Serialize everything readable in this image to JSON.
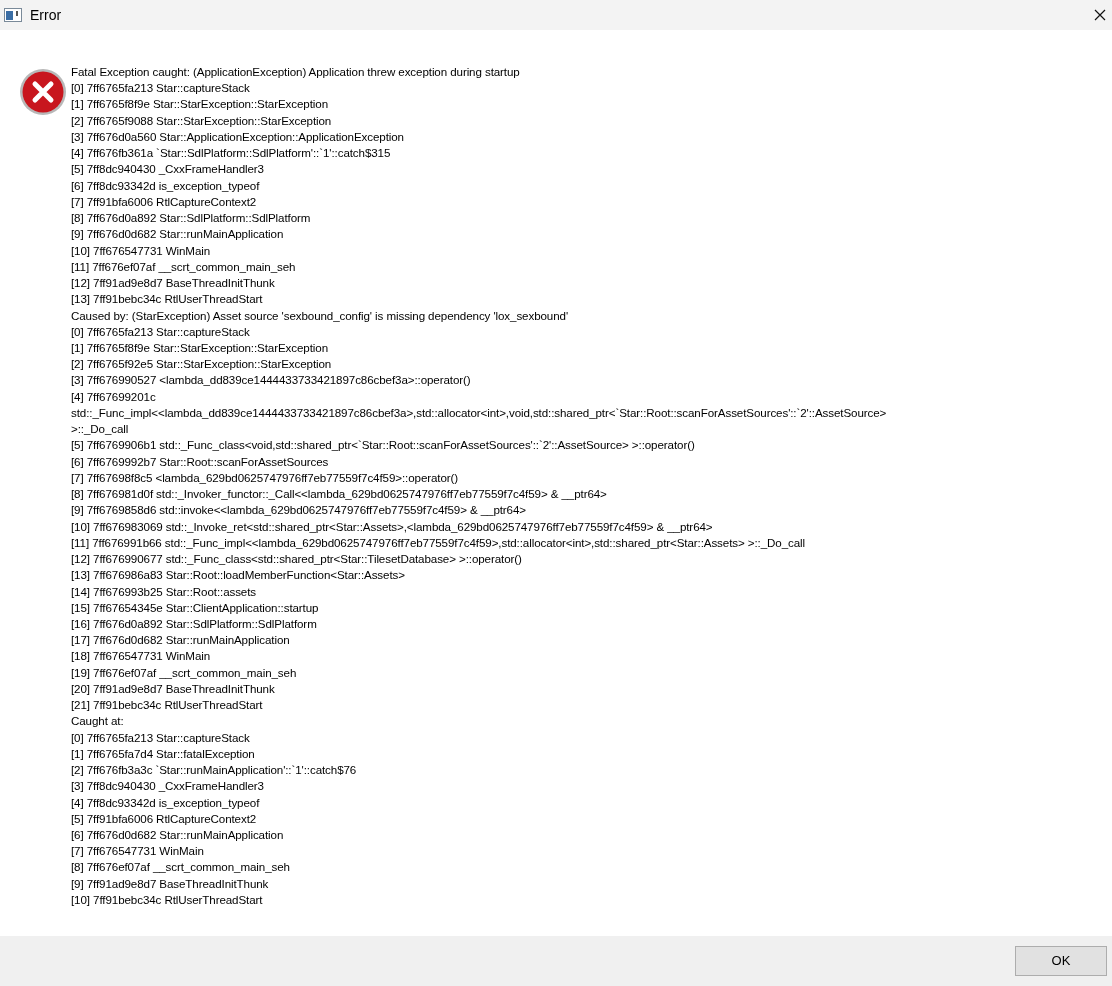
{
  "window": {
    "title": "Error"
  },
  "message": {
    "lines": [
      "Fatal Exception caught: (ApplicationException) Application threw exception during startup",
      "[0] 7ff6765fa213 Star::captureStack",
      "[1] 7ff6765f8f9e Star::StarException::StarException",
      "[2] 7ff6765f9088 Star::StarException::StarException",
      "[3] 7ff676d0a560 Star::ApplicationException::ApplicationException",
      "[4] 7ff676fb361a `Star::SdlPlatform::SdlPlatform'::`1'::catch$315",
      "[5] 7ff8dc940430 _CxxFrameHandler3",
      "[6] 7ff8dc93342d is_exception_typeof",
      "[7] 7ff91bfa6006 RtlCaptureContext2",
      "[8] 7ff676d0a892 Star::SdlPlatform::SdlPlatform",
      "[9] 7ff676d0d682 Star::runMainApplication",
      "[10] 7ff676547731 WinMain",
      "[11] 7ff676ef07af __scrt_common_main_seh",
      "[12] 7ff91ad9e8d7 BaseThreadInitThunk",
      "[13] 7ff91bebc34c RtlUserThreadStart",
      "Caused by: (StarException) Asset source 'sexbound_config' is missing dependency 'lox_sexbound'",
      "[0] 7ff6765fa213 Star::captureStack",
      "[1] 7ff6765f8f9e Star::StarException::StarException",
      "[2] 7ff6765f92e5 Star::StarException::StarException",
      "[3] 7ff676990527 <lambda_dd839ce1444433733421897c86cbef3a>::operator()",
      "[4] 7ff67699201c",
      "std::_Func_impl<<lambda_dd839ce1444433733421897c86cbef3a>,std::allocator<int>,void,std::shared_ptr<`Star::Root::scanForAssetSources'::`2'::AssetSource>",
      ">::_Do_call",
      "[5] 7ff6769906b1 std::_Func_class<void,std::shared_ptr<`Star::Root::scanForAssetSources'::`2'::AssetSource> >::operator()",
      "[6] 7ff6769992b7 Star::Root::scanForAssetSources",
      "[7] 7ff67698f8c5 <lambda_629bd0625747976ff7eb77559f7c4f59>::operator()",
      "[8] 7ff676981d0f std::_Invoker_functor::_Call<<lambda_629bd0625747976ff7eb77559f7c4f59> & __ptr64>",
      "[9] 7ff6769858d6 std::invoke<<lambda_629bd0625747976ff7eb77559f7c4f59> & __ptr64>",
      "[10] 7ff676983069 std::_Invoke_ret<std::shared_ptr<Star::Assets>,<lambda_629bd0625747976ff7eb77559f7c4f59> & __ptr64>",
      "[11] 7ff676991b66 std::_Func_impl<<lambda_629bd0625747976ff7eb77559f7c4f59>,std::allocator<int>,std::shared_ptr<Star::Assets> >::_Do_call",
      "[12] 7ff676990677 std::_Func_class<std::shared_ptr<Star::TilesetDatabase> >::operator()",
      "[13] 7ff676986a83 Star::Root::loadMemberFunction<Star::Assets>",
      "[14] 7ff676993b25 Star::Root::assets",
      "[15] 7ff67654345e Star::ClientApplication::startup",
      "[16] 7ff676d0a892 Star::SdlPlatform::SdlPlatform",
      "[17] 7ff676d0d682 Star::runMainApplication",
      "[18] 7ff676547731 WinMain",
      "[19] 7ff676ef07af __scrt_common_main_seh",
      "[20] 7ff91ad9e8d7 BaseThreadInitThunk",
      "[21] 7ff91bebc34c RtlUserThreadStart",
      "Caught at:",
      "[0] 7ff6765fa213 Star::captureStack",
      "[1] 7ff6765fa7d4 Star::fatalException",
      "[2] 7ff676fb3a3c `Star::runMainApplication'::`1'::catch$76",
      "[3] 7ff8dc940430 _CxxFrameHandler3",
      "[4] 7ff8dc93342d is_exception_typeof",
      "[5] 7ff91bfa6006 RtlCaptureContext2",
      "[6] 7ff676d0d682 Star::runMainApplication",
      "[7] 7ff676547731 WinMain",
      "[8] 7ff676ef07af __scrt_common_main_seh",
      "[9] 7ff91ad9e8d7 BaseThreadInitThunk",
      "[10] 7ff91bebc34c RtlUserThreadStart"
    ]
  },
  "buttons": [
    {
      "label": "OK"
    }
  ]
}
